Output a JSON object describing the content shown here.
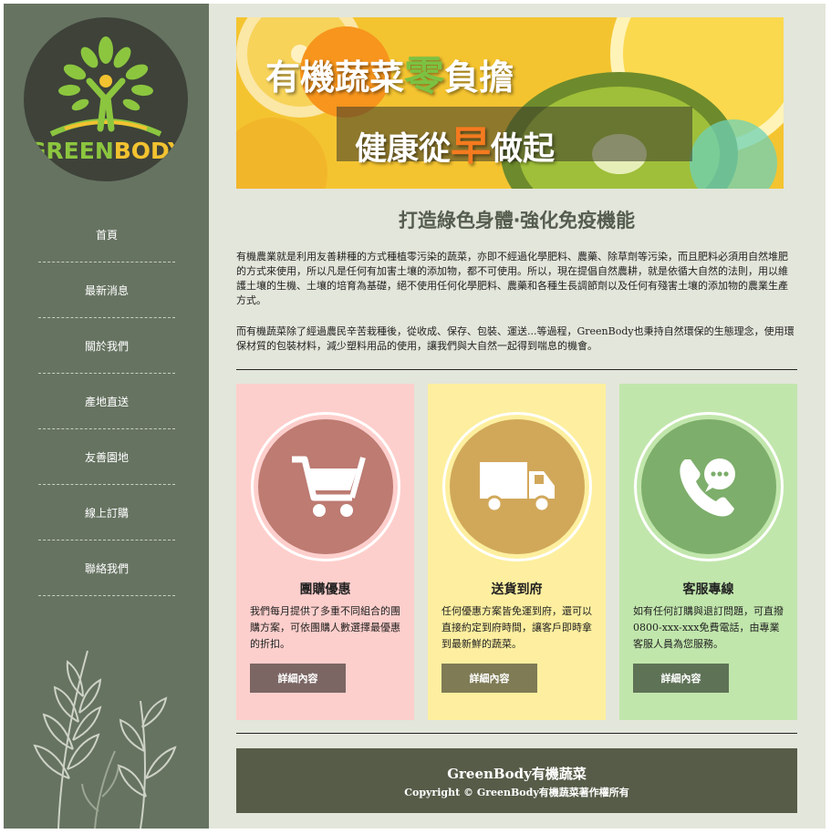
{
  "brand": {
    "logo_text_green": "GREEN",
    "logo_text_yellow": "BODY",
    "colors": {
      "sidebar": "#667361",
      "green": "#8cc63f",
      "yellow": "#f2c230",
      "page_bg": "#e3e6da"
    }
  },
  "sidebar": {
    "items": [
      {
        "label": "首頁"
      },
      {
        "label": "最新消息"
      },
      {
        "label": "關於我們"
      },
      {
        "label": "產地直送"
      },
      {
        "label": "友善園地"
      },
      {
        "label": "線上訂購"
      },
      {
        "label": "聯絡我們"
      }
    ]
  },
  "banner": {
    "line1_pre": "有機蔬菜",
    "line1_highlight": "零",
    "line1_post": "負擔",
    "line2_pre": "健康從",
    "line2_highlight": "早",
    "line2_post": "做起"
  },
  "main": {
    "title": "打造綠色身體‧強化免疫機能",
    "paragraph1": "有機農業就是利用友善耕種的方式種植零污染的蔬菜，亦即不經過化學肥料、農藥、除草劑等污染，而且肥料必須用自然堆肥的方式來使用，所以凡是任何有加害土壤的添加物，都不可使用。所以，現在提倡自然農耕，就是依循大自然的法則，用以維護土壤的生機、土壤的培育為基礎，絕不使用任何化學肥料、農藥和各種生長調節劑以及任何有殘害土壤的添加物的農業生產方式。",
    "paragraph2": "而有機蔬菜除了經過農民辛苦栽種後，從收成、保存、包裝、運送...等過程，GreenBody也秉持自然環保的生態理念，使用環保材質的包裝材料，減少塑料用品的使用，讓我們與大自然一起得到喘息的機會。"
  },
  "cards": [
    {
      "icon": "shopping-cart-icon",
      "title": "團購優惠",
      "text": "我們每月提供了多重不同組合的團購方案，可依團購人數選擇最優惠的折扣。",
      "button": "詳細內容",
      "color": "#fdcfcc"
    },
    {
      "icon": "delivery-truck-icon",
      "title": "送貨到府",
      "text": "任何優惠方案皆免運到府，還可以直接約定到府時間，讓客戶即時拿到最新鮮的蔬菜。",
      "button": "詳細內容",
      "color": "#fdef9f"
    },
    {
      "icon": "phone-chat-icon",
      "title": "客服專線",
      "text": "如有任何訂購與退訂問題，可直撥0800-xxx-xxx免費電話，由專業客服人員為您服務。",
      "button": "詳細內容",
      "color": "#c1e6ac"
    }
  ],
  "footer": {
    "title": "GreenBody有機蔬菜",
    "copyright": "Copyright © GreenBody有機蔬菜著作權所有"
  }
}
